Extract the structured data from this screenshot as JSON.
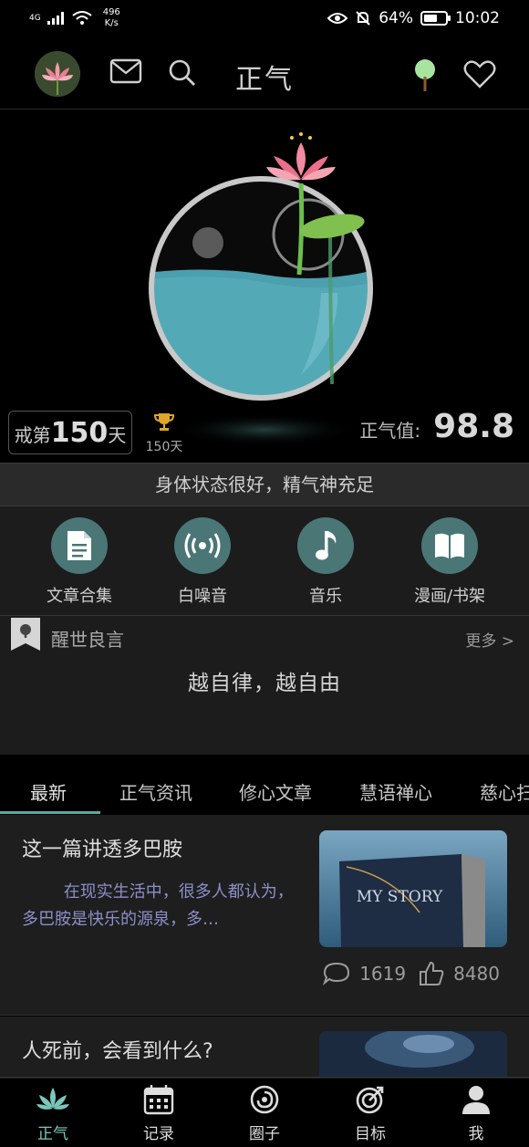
{
  "status_bar": {
    "network": "4G",
    "speed_value": "496",
    "speed_unit": "K/s",
    "battery": "64%",
    "battery_level": 0.64,
    "time": "10:02"
  },
  "header": {
    "title": "正气",
    "icons": [
      "avatar",
      "mail-icon",
      "search-icon",
      "tree-icon",
      "heart-icon"
    ]
  },
  "hero": {
    "streak_prefix": "戒第",
    "streak_days": "150",
    "streak_suffix": "天",
    "trophy_label": "150天",
    "zhengqi_label": "正气值:",
    "zhengqi_value": "98.8"
  },
  "status_message": "身体状态很好，精气神充足",
  "features": [
    {
      "label": "文章合集",
      "icon": "document-icon"
    },
    {
      "label": "白噪音",
      "icon": "broadcast-icon"
    },
    {
      "label": "音乐",
      "icon": "music-note-icon"
    },
    {
      "label": "漫画/书架",
      "icon": "book-icon"
    }
  ],
  "quote": {
    "title": "醒世良言",
    "more": "更多 >",
    "text": "越自律，越自由"
  },
  "tabs": [
    {
      "label": "最新"
    },
    {
      "label": "正气资讯"
    },
    {
      "label": "修心文章"
    },
    {
      "label": "慧语禅心"
    },
    {
      "label": "慈心扫"
    }
  ],
  "articles": [
    {
      "title": "这一篇讲透多巴胺",
      "excerpt": "        在现实生活中，很多人都认为，多巴胺是快乐的源泉，多…",
      "thumb_text": "MY STORY",
      "comments": "1619",
      "likes": "8480"
    },
    {
      "title": "人死前，会看到什么?"
    }
  ],
  "bottom_nav": [
    {
      "label": "正气",
      "icon": "lotus-icon",
      "active": true
    },
    {
      "label": "记录",
      "icon": "calendar-icon",
      "active": false
    },
    {
      "label": "圈子",
      "icon": "circle-icon",
      "active": false
    },
    {
      "label": "目标",
      "icon": "target-icon",
      "active": false
    },
    {
      "label": "我",
      "icon": "person-icon",
      "active": false
    }
  ],
  "colors": {
    "accent": "#5ca9a0",
    "feature_circle": "#4a7676",
    "excerpt": "#8d8fc9"
  }
}
